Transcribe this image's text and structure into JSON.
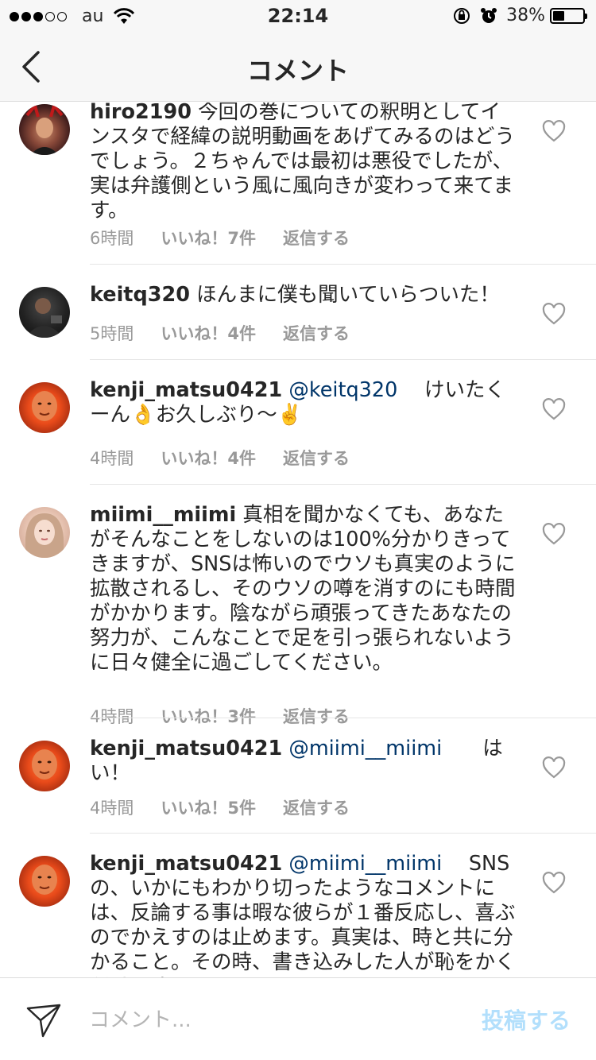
{
  "status_bar": {
    "carrier": "au",
    "time": "22:14",
    "battery_percent": "38%",
    "battery_level": 0.38,
    "icons": [
      "signal-dots",
      "wifi-icon",
      "rotation-lock-icon",
      "alarm-icon",
      "battery-icon"
    ]
  },
  "nav": {
    "title": "コメント",
    "back_icon": "chevron-left-icon"
  },
  "comments": [
    {
      "username": "hiro2190",
      "mention": "",
      "text": " 今回の巻についての釈明としてインスタで経緯の説明動画をあげてみるのはどうでしょう。２ちゃんでは最初は悪役でしたが、実は弁護側という風に風向きが変わって来てます。",
      "time": "6時間",
      "likes": "いいね！7件",
      "reply": "返信する"
    },
    {
      "username": "keitq320",
      "mention": "",
      "text": " ほんまに僕も聞いていらついた！",
      "time": "5時間",
      "likes": "いいね！4件",
      "reply": "返信する"
    },
    {
      "username": "kenji_matsu0421",
      "mention": "@keitq320",
      "text": "　 けいたくーん👌お久しぶり〜✌️",
      "time": "4時間",
      "likes": "いいね！4件",
      "reply": "返信する"
    },
    {
      "username": "miimi__miimi",
      "mention": "",
      "text": " 真相を聞かなくても、あなたがそんなことをしないのは100%分かりきってきますが、SNSは怖いのでウソも真実のように拡散されるし、そのウソの噂を消すのにも時間がかかります。陰ながら頑張ってきたあなたの努力が、こんなことで足を引っ張られないように日々健全に過ごしてください。",
      "time": "4時間",
      "likes": "いいね！3件",
      "reply": "返信する"
    },
    {
      "username": "kenji_matsu0421",
      "mention": "@miimi__miimi",
      "text": "　　はい！",
      "time": "4時間",
      "likes": "いいね！5件",
      "reply": "返信する"
    },
    {
      "username": "kenji_matsu0421",
      "mention": "@miimi__miimi",
      "text": "　 SNSの、いかにもわかり切ったようなコメントには、反論する事は暇な彼らが１番反応し、喜ぶのでかえすのは止めます。真実は、時と共に分かること。その時、書き込みした人が恥をかくだけです!!",
      "time": "",
      "likes": "",
      "reply": ""
    }
  ],
  "composer": {
    "placeholder": "コメント...",
    "post_label": "投稿する",
    "post_color": "#b2dffc"
  },
  "colors": {
    "mention": "#003569",
    "meta": "#999999",
    "bar_bg": "#f7f7f7"
  }
}
